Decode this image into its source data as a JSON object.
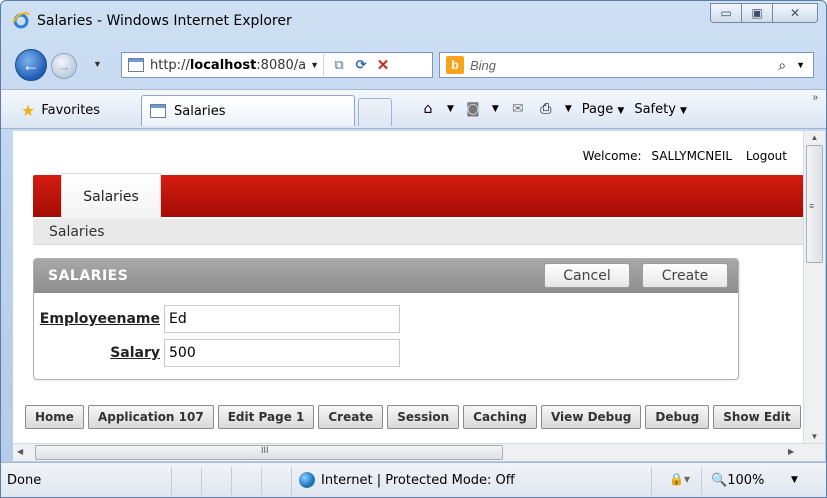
{
  "browser": {
    "title": "Salaries - Windows Internet Explorer",
    "url_prefix": "http://",
    "url_host": "localhost",
    "url_rest": ":8080/a",
    "search_placeholder": "Bing",
    "favorites_label": "Favorites",
    "tab_title": "Salaries",
    "command_bar": {
      "page_label": "Page",
      "safety_label": "Safety"
    }
  },
  "page": {
    "welcome_label": "Welcome:",
    "user": "SALLYMCNEIL",
    "logout_label": "Logout",
    "nav_tab": "Salaries",
    "breadcrumb": "Salaries",
    "region": {
      "title": "SALARIES",
      "cancel_label": "Cancel",
      "create_label": "Create",
      "fields": [
        {
          "label": "Employeename",
          "value": "Ed"
        },
        {
          "label": "Salary",
          "value": "500"
        }
      ]
    },
    "dev_toolbar": [
      "Home",
      "Application 107",
      "Edit Page 1",
      "Create",
      "Session",
      "Caching",
      "View Debug",
      "Debug",
      "Show Edit"
    ]
  },
  "status": {
    "left": "Done",
    "zone": "Internet | Protected Mode: Off",
    "zoom": "100%"
  }
}
